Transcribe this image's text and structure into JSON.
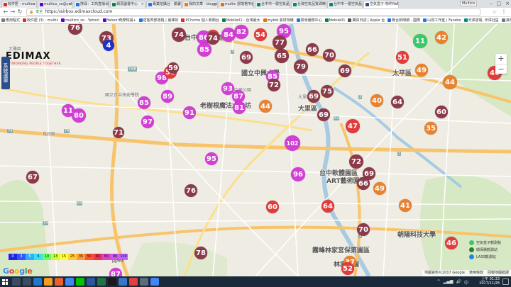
{
  "browser": {
    "tabs": [
      {
        "label": "收件匣 - multico",
        "active": false,
        "fav": "#d93025"
      },
      {
        "label": "multico_so@yahoo",
        "active": false,
        "fav": "#6001d2"
      },
      {
        "label": "搜尋：工商直播 組図",
        "active": false,
        "fav": "#1a73e8"
      },
      {
        "label": "網頁圖書中心",
        "active": false,
        "fav": "#0b8043"
      },
      {
        "label": "專業拍攝台 - 臉書",
        "active": false,
        "fav": "#1877f2"
      },
      {
        "label": "我的文章 - blogger",
        "active": false,
        "fav": "#f57d00"
      },
      {
        "label": "multic 部落格平台",
        "active": false,
        "fav": "#e37400"
      },
      {
        "label": "台中市一層空氣品",
        "active": false,
        "fav": "#00897b"
      },
      {
        "label": "台灣空氣品質即時監",
        "active": false,
        "fav": "#00897b"
      },
      {
        "label": "台中市一層空氣品",
        "active": false,
        "fav": "#00897b"
      },
      {
        "label": "空氣盒子-物件RUI",
        "active": true,
        "fav": "#2c4c8a"
      }
    ],
    "user_badge": "Multico",
    "url": "https://airbox.edimaxcloud.com",
    "secure_label": "安全",
    "bookmarks": [
      {
        "label": "應用程式",
        "fav": "#777"
      },
      {
        "label": "收件匣 (3) - multic",
        "fav": "#d93025"
      },
      {
        "label": "multico_so - Yahoo!",
        "fav": "#6001d2"
      },
      {
        "label": "Yahoo!奇摩知識+",
        "fav": "#6001d2"
      },
      {
        "label": "痞客邦部落格 | 最棒的",
        "fav": "#1a73e8"
      },
      {
        "label": "PChome 個人新聞台",
        "fav": "#d93025"
      },
      {
        "label": "Mobile01 - 台灣最大",
        "fav": "#0b8043"
      },
      {
        "label": "mybid 素材特價",
        "fav": "#e37400"
      },
      {
        "label": "搜尋服務中心",
        "fav": "#1a73e8"
      },
      {
        "label": "Mobile01",
        "fav": "#0b8043"
      },
      {
        "label": "購買日誌 | Apple 台",
        "fav": "#555"
      },
      {
        "label": "聯合新聞網 - 國際",
        "fav": "#1a73e8"
      },
      {
        "label": "山洞工作室 | Facebo",
        "fav": "#1877f2"
      },
      {
        "label": "天澤發電, 天澤社區",
        "fav": "#00897b"
      },
      {
        "label": "其他書籤",
        "fav": "#777"
      }
    ]
  },
  "map": {
    "sidebar_tab": "系統選單",
    "logo": {
      "brand": "EDIMAX",
      "tagline": "NETWORKING PEOPLE TOGETHER"
    },
    "zoom_in": "+",
    "zoom_out": "−",
    "labels": [
      {
        "text": "台中國家歌劇院",
        "kind": "place"
      },
      {
        "text": "國立中興大學",
        "kind": "place"
      },
      {
        "text": "老樹根魔法木工坊",
        "kind": "place"
      },
      {
        "text": "大里區",
        "kind": "place"
      },
      {
        "text": "台中軟體園區",
        "kind": "place"
      },
      {
        "text": "ART藝術園區",
        "kind": "place"
      },
      {
        "text": "朝陽科技大學",
        "kind": "place"
      },
      {
        "text": "霧峰林家宮保第園區",
        "kind": "place"
      },
      {
        "text": "林家花園",
        "kind": "place"
      },
      {
        "text": "太平區",
        "kind": "place"
      },
      {
        "text": "大雅區",
        "kind": "small"
      },
      {
        "text": "烏日區",
        "kind": "small"
      },
      {
        "text": "國立台中技術學院",
        "kind": "small"
      },
      {
        "text": "中央公園",
        "kind": "small"
      },
      {
        "text": "大里區",
        "kind": "small"
      }
    ],
    "road_badges": [
      "74",
      "74",
      "63",
      "3",
      "1",
      "74甲",
      "3",
      "63",
      "74",
      "3"
    ],
    "markers": [
      {
        "v": "76",
        "color": "#8b3a4a"
      },
      {
        "v": "73",
        "color": "#8b3a4a"
      },
      {
        "v": "74",
        "color": "#8b3a4a"
      },
      {
        "v": "54",
        "color": "#e23b3b"
      },
      {
        "v": "86",
        "color": "#d23ed6"
      },
      {
        "v": "74",
        "color": "#8b3a4a"
      },
      {
        "v": "84",
        "color": "#d23ed6"
      },
      {
        "v": "82",
        "color": "#d23ed6"
      },
      {
        "v": "54",
        "color": "#e23b3b"
      },
      {
        "v": "95",
        "color": "#d23ed6"
      },
      {
        "v": "77",
        "color": "#8b3a4a"
      },
      {
        "v": "85",
        "color": "#d23ed6"
      },
      {
        "v": "69",
        "color": "#8b3a4a"
      },
      {
        "v": "65",
        "color": "#8b3a4a"
      },
      {
        "v": "66",
        "color": "#8b3a4a"
      },
      {
        "v": "70",
        "color": "#8b3a4a"
      },
      {
        "v": "79",
        "color": "#8b3a4a"
      },
      {
        "v": "69",
        "color": "#8b3a4a"
      },
      {
        "v": "51",
        "color": "#e23b3b"
      },
      {
        "v": "11",
        "color": "#39c86a"
      },
      {
        "v": "42",
        "color": "#e8822f"
      },
      {
        "v": "49",
        "color": "#e8822f"
      },
      {
        "v": "46",
        "color": "#e23b3b"
      },
      {
        "v": "98",
        "color": "#d23ed6"
      },
      {
        "v": "58",
        "color": "#e23b3b"
      },
      {
        "v": "93",
        "color": "#d23ed6"
      },
      {
        "v": "85",
        "color": "#d23ed6"
      },
      {
        "v": "72",
        "color": "#8b3a4a"
      },
      {
        "v": "69",
        "color": "#8b3a4a"
      },
      {
        "v": "75",
        "color": "#8b3a4a"
      },
      {
        "v": "44",
        "color": "#e8822f"
      },
      {
        "v": "89",
        "color": "#d23ed6"
      },
      {
        "v": "87",
        "color": "#d23ed6"
      },
      {
        "v": "81",
        "color": "#d23ed6"
      },
      {
        "v": "44",
        "color": "#e8822f"
      },
      {
        "v": "40",
        "color": "#e8822f"
      },
      {
        "v": "64",
        "color": "#8b3a4a"
      },
      {
        "v": "60",
        "color": "#8b3a4a"
      },
      {
        "v": "11",
        "color": "#d23ed6"
      },
      {
        "v": "80",
        "color": "#d23ed6"
      },
      {
        "v": "85",
        "color": "#d23ed6"
      },
      {
        "v": "97",
        "color": "#d23ed6"
      },
      {
        "v": "91",
        "color": "#d23ed6"
      },
      {
        "v": "69",
        "color": "#8b3a4a"
      },
      {
        "v": "47",
        "color": "#e23b3b"
      },
      {
        "v": "35",
        "color": "#e8822f"
      },
      {
        "v": "102",
        "color": "#d23ed6"
      },
      {
        "v": "95",
        "color": "#d23ed6"
      },
      {
        "v": "72",
        "color": "#8b3a4a"
      },
      {
        "v": "69",
        "color": "#8b3a4a"
      },
      {
        "v": "96",
        "color": "#d23ed6"
      },
      {
        "v": "66",
        "color": "#8b3a4a"
      },
      {
        "v": "67",
        "color": "#8b3a4a"
      },
      {
        "v": "76",
        "color": "#8b3a4a"
      },
      {
        "v": "49",
        "color": "#e8822f"
      },
      {
        "v": "60",
        "color": "#e23b3b"
      },
      {
        "v": "64",
        "color": "#e23b3b"
      },
      {
        "v": "41",
        "color": "#e8822f"
      },
      {
        "v": "70",
        "color": "#8b3a4a"
      },
      {
        "v": "46",
        "color": "#e23b3b"
      },
      {
        "v": "78",
        "color": "#8b3a4a"
      },
      {
        "v": "37",
        "color": "#e8822f"
      },
      {
        "v": "52",
        "color": "#e23b3b"
      },
      {
        "v": "87",
        "color": "#d23ed6"
      },
      {
        "v": "4",
        "color": "#1d2fd0"
      },
      {
        "v": "71",
        "color": "#8b3a4a"
      },
      {
        "v": "59",
        "color": "#8b3a4a"
      }
    ],
    "legend": [
      {
        "v": "0",
        "c": "#2222ee"
      },
      {
        "v": "3",
        "c": "#3355ff"
      },
      {
        "v": "5",
        "c": "#33aaff"
      },
      {
        "v": "6",
        "c": "#33e0ff"
      },
      {
        "v": "10",
        "c": "#66ff66"
      },
      {
        "v": "13",
        "c": "#ccff33"
      },
      {
        "v": "15",
        "c": "#ffff33"
      },
      {
        "v": "25",
        "c": "#ffcc33"
      },
      {
        "v": "35",
        "c": "#ff9933"
      },
      {
        "v": "50",
        "c": "#ff5533"
      },
      {
        "v": "65",
        "c": "#ee3355"
      },
      {
        "v": "80",
        "c": "#dd44cc"
      },
      {
        "v": "90",
        "c": "#cc55ee"
      },
      {
        "v": "100",
        "c": "#bb66ff"
      }
    ],
    "legend_unit": "μg/m3",
    "site_legend": [
      {
        "label": "空氣盒子觀測點",
        "color": "#39c86a"
      },
      {
        "label": "環保署觀測站",
        "color": "#2e7d32"
      },
      {
        "label": "LASS觀測站",
        "color": "#1e88e5"
      }
    ],
    "google": "Google",
    "attribution": "地圖資料©2017 Google",
    "terms": "使用條款",
    "report": "回報地圖錯誤"
  },
  "taskbar": {
    "time": "上午 01:33",
    "date": "2017/11/28",
    "ime": "中"
  }
}
